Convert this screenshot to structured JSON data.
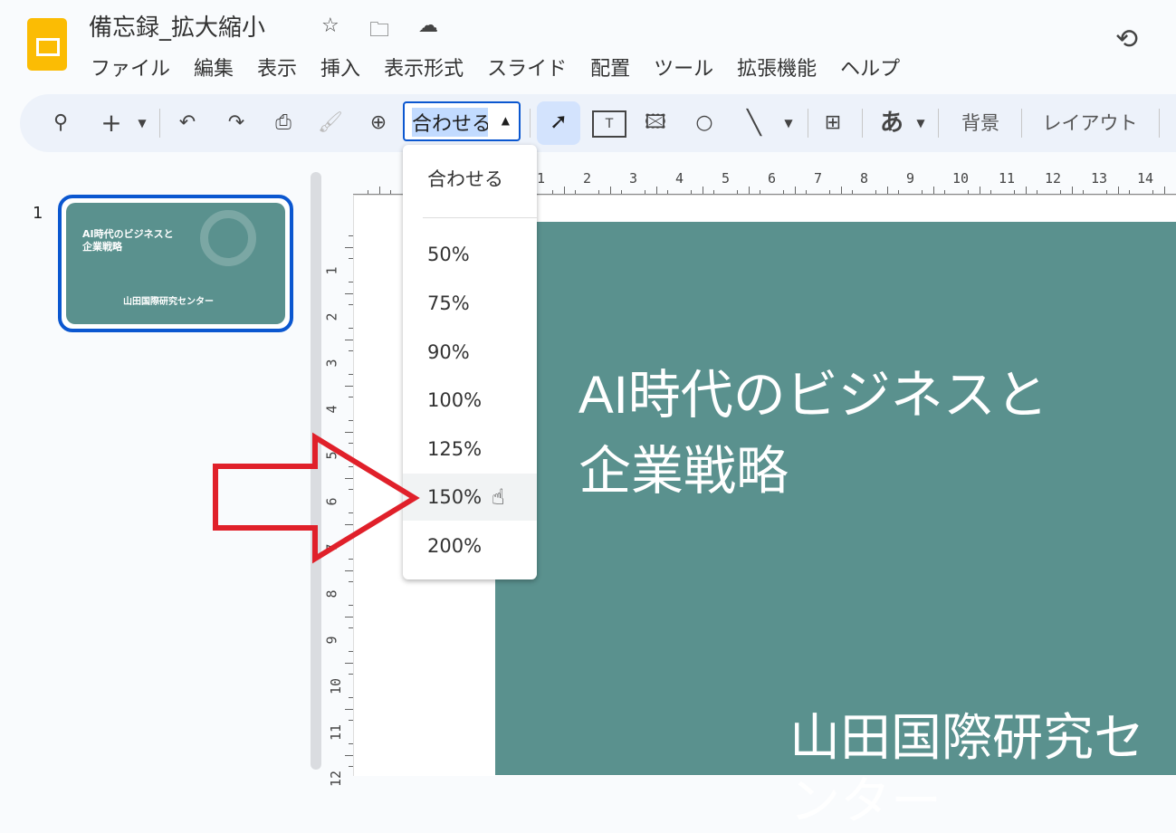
{
  "doc": {
    "title": "備忘録_拡大縮小"
  },
  "menu": [
    "ファイル",
    "編集",
    "表示",
    "挿入",
    "表示形式",
    "スライド",
    "配置",
    "ツール",
    "拡張機能",
    "ヘルプ"
  ],
  "toolbar": {
    "zoom_value": "合わせる",
    "background": "背景",
    "layout": "レイアウト",
    "font_glyph": "あ"
  },
  "zoom_menu": {
    "fit": "合わせる",
    "options": [
      "50%",
      "75%",
      "90%",
      "100%",
      "125%",
      "150%",
      "200%"
    ],
    "hovered": "150%"
  },
  "slides": [
    {
      "number": "1",
      "title": "AI時代のビジネスと企業戦略",
      "title_line1": "AI時代のビジネスと",
      "title_line2": "企業戦略",
      "subtitle": "山田国際研究センター"
    }
  ],
  "ruler": {
    "h": [
      "1",
      "2",
      "3",
      "4",
      "5",
      "6",
      "7",
      "8",
      "9",
      "10",
      "11",
      "12",
      "13",
      "14"
    ],
    "v": [
      "1",
      "2",
      "3",
      "4",
      "5",
      "6",
      "7",
      "8",
      "9",
      "10",
      "11",
      "12"
    ]
  },
  "colors": {
    "accent": "#0b57d0",
    "slide_bg": "#5a918e",
    "annotation_arrow": "#e0202a"
  }
}
